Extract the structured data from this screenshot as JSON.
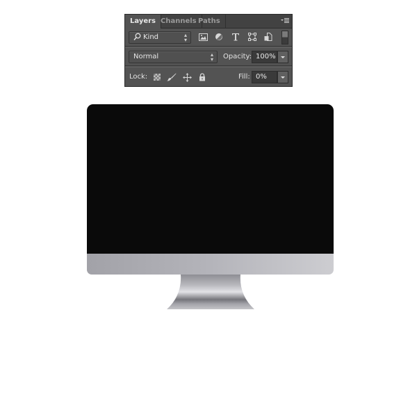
{
  "layers_panel": {
    "tabs": [
      {
        "label": "Layers",
        "active": true
      },
      {
        "label": "Channels",
        "active": false
      },
      {
        "label": "Paths",
        "active": false
      }
    ],
    "panel_menu_icon": "panel-menu-icon",
    "filter": {
      "search_icon": "search-icon",
      "kind_label": "Kind",
      "filter_icons": [
        "pixel-layer-filter-icon",
        "adjustment-layer-filter-icon",
        "type-layer-filter-icon",
        "shape-layer-filter-icon",
        "smart-object-filter-icon"
      ],
      "toggle": "filter-toggle"
    },
    "blend": {
      "mode": "Normal",
      "opacity_label": "Opacity:",
      "opacity_value": "100%"
    },
    "lock": {
      "label": "Lock:",
      "icons": [
        "lock-transparent-pixels-icon",
        "lock-image-pixels-icon",
        "lock-position-icon",
        "lock-all-icon"
      ],
      "fill_label": "Fill:",
      "fill_value": "0%"
    }
  },
  "canvas": {
    "monitor": {
      "screen_color": "#0a0a0a",
      "chin_colors": [
        "#a2a2a8",
        "#cdcdd1"
      ],
      "stand_colors": [
        "#8e8e94",
        "#e2e2e6",
        "#75757b"
      ]
    }
  }
}
